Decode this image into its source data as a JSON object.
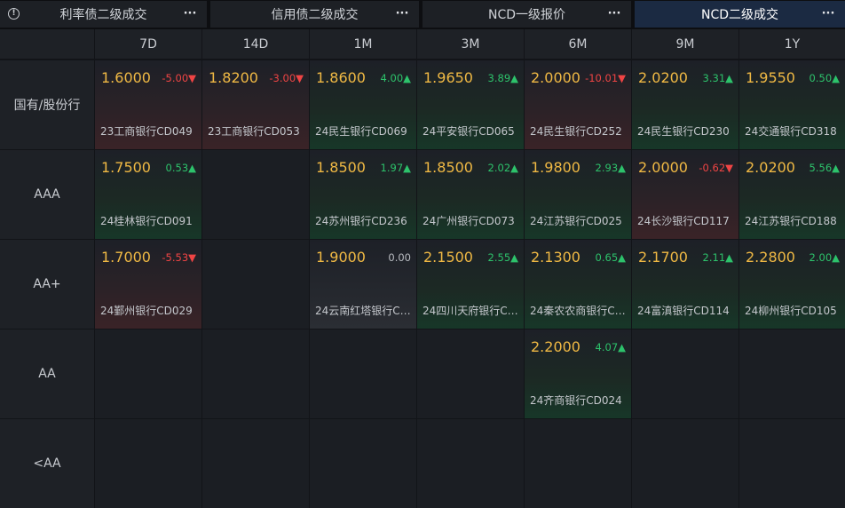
{
  "tabs": [
    {
      "label": "利率债二级成交",
      "more": "···",
      "active": false
    },
    {
      "label": "信用债二级成交",
      "more": "···",
      "active": false
    },
    {
      "label": "NCD一级报价",
      "more": "···",
      "active": false
    },
    {
      "label": "NCD二级成交",
      "more": "···",
      "active": true
    }
  ],
  "info_icon": "info-icon",
  "columns": [
    "7D",
    "14D",
    "1M",
    "3M",
    "6M",
    "9M",
    "1Y"
  ],
  "rows": [
    {
      "label": "国有/股份行",
      "cells": [
        {
          "price": "1.6000",
          "change": "-5.00▼",
          "bond": "23工商银行CD049",
          "dir": "down"
        },
        {
          "price": "1.8200",
          "change": "-3.00▼",
          "bond": "23工商银行CD053",
          "dir": "down"
        },
        {
          "price": "1.8600",
          "change": "4.00▲",
          "bond": "24民生银行CD069",
          "dir": "up"
        },
        {
          "price": "1.9650",
          "change": "3.89▲",
          "bond": "24平安银行CD065",
          "dir": "up"
        },
        {
          "price": "2.0000",
          "change": "-10.01▼",
          "bond": "24民生银行CD252",
          "dir": "down"
        },
        {
          "price": "2.0200",
          "change": "3.31▲",
          "bond": "24民生银行CD230",
          "dir": "up"
        },
        {
          "price": "1.9550",
          "change": "0.50▲",
          "bond": "24交通银行CD318",
          "dir": "up"
        }
      ]
    },
    {
      "label": "AAA",
      "cells": [
        {
          "price": "1.7500",
          "change": "0.53▲",
          "bond": "24桂林银行CD091",
          "dir": "up"
        },
        null,
        {
          "price": "1.8500",
          "change": "1.97▲",
          "bond": "24苏州银行CD236",
          "dir": "up"
        },
        {
          "price": "1.8500",
          "change": "2.02▲",
          "bond": "24广州银行CD073",
          "dir": "up"
        },
        {
          "price": "1.9800",
          "change": "2.93▲",
          "bond": "24江苏银行CD025",
          "dir": "up"
        },
        {
          "price": "2.0000",
          "change": "-0.62▼",
          "bond": "24长沙银行CD117",
          "dir": "down"
        },
        {
          "price": "2.0200",
          "change": "5.56▲",
          "bond": "24江苏银行CD188",
          "dir": "up"
        }
      ]
    },
    {
      "label": "AA+",
      "cells": [
        {
          "price": "1.7000",
          "change": "-5.53▼",
          "bond": "24鄞州银行CD029",
          "dir": "down"
        },
        null,
        {
          "price": "1.9000",
          "change": "0.00",
          "bond": "24云南红塔银行CD..",
          "dir": "flat"
        },
        {
          "price": "2.1500",
          "change": "2.55▲",
          "bond": "24四川天府银行CD..",
          "dir": "up"
        },
        {
          "price": "2.1300",
          "change": "0.65▲",
          "bond": "24秦农农商银行CD..",
          "dir": "up"
        },
        {
          "price": "2.1700",
          "change": "2.11▲",
          "bond": "24富滇银行CD114",
          "dir": "up"
        },
        {
          "price": "2.2800",
          "change": "2.00▲",
          "bond": "24柳州银行CD105",
          "dir": "up"
        }
      ]
    },
    {
      "label": "AA",
      "cells": [
        null,
        null,
        null,
        null,
        {
          "price": "2.2000",
          "change": "4.07▲",
          "bond": "24齐商银行CD024",
          "dir": "up"
        },
        null,
        null
      ]
    },
    {
      "label": "<AA",
      "cells": [
        null,
        null,
        null,
        null,
        null,
        null,
        null
      ]
    }
  ],
  "colors": {
    "price": "#f0b944",
    "up": "#2dc26b",
    "down": "#ef4444",
    "active_tab": "#1b2a42"
  }
}
